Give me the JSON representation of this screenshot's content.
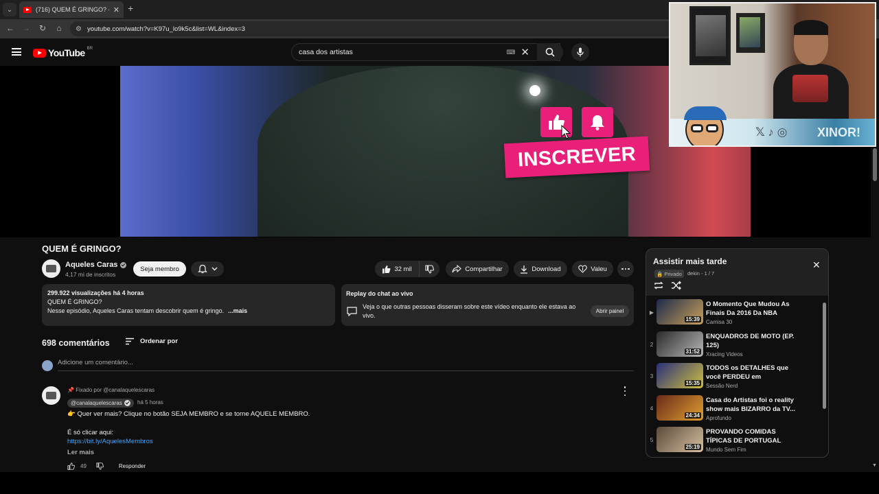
{
  "browser": {
    "tab_title": "(716) QUEM É GRINGO? - YouTube",
    "url": "youtube.com/watch?v=K97u_lo9k5c&list=WL&index=3"
  },
  "header": {
    "logo_text": "YouTube",
    "country": "BR",
    "search_query": "casa dos artistas"
  },
  "overlay": {
    "subscribe_text": "INSCREVER"
  },
  "webcam": {
    "tag_text": "XINOR!"
  },
  "video": {
    "title": "QUEM É GRINGO?",
    "channel": "Aqueles Caras",
    "subscribers": "4,17 mi de inscritos",
    "join_label": "Seja membro",
    "likes": "32 mil",
    "share_label": "Compartilhar",
    "download_label": "Download",
    "thanks_label": "Valeu"
  },
  "description": {
    "stats": "299.922 visualizações  há 4 horas",
    "line1": "QUEM É GRINGO?",
    "line2": "Nesse episódio, Aqueles Caras tentam descobrir quem é gringo.",
    "more": "...mais"
  },
  "chat": {
    "title": "Replay do chat ao vivo",
    "text": "Veja o que outras pessoas disseram sobre este vídeo enquanto ele estava ao vivo.",
    "button": "Abrir painel"
  },
  "comments": {
    "count": "698 comentários",
    "sort_label": "Ordenar por",
    "add_placeholder": "Adicione um comentário...",
    "pinned": {
      "pinned_label": "Fixado por @canalaquelescaras",
      "author": "@canalaquelescaras",
      "time": "há 5 horas",
      "line1": "👉 Quer ver mais? Clique no botão SEJA MEMBRO e se torne AQUELE MEMBRO.",
      "line2": "É só clicar aqui:",
      "link": "https://bit.ly/AquelesMembros",
      "read_more": "Ler mais",
      "likes": "49",
      "reply": "Responder"
    }
  },
  "playlist": {
    "title": "Assistir mais tarde",
    "privacy": "Privado",
    "owner": "dekin - 1 / 7",
    "items": [
      {
        "index": "▶",
        "title": "O Momento Que Mudou As Finais Da 2016 Da NBA",
        "channel": "Camisa 30",
        "duration": "15:39",
        "thumb": [
          "#1d2a4a",
          "#c9a15a"
        ]
      },
      {
        "index": "2",
        "title": "ENQUADROS DE MOTO (EP. 125)",
        "channel": "Xracing Videos",
        "duration": "31:52",
        "thumb": [
          "#2b2b2b",
          "#b8b8b8"
        ]
      },
      {
        "index": "3",
        "title": "TODOS os DETALHES que você PERDEU em QUARTETO...",
        "channel": "Sessão Nerd",
        "duration": "15:35",
        "thumb": [
          "#2a2f7a",
          "#d0c040"
        ]
      },
      {
        "index": "4",
        "title": "Casa do Artistas foi o reality show mais BIZARRO da TV...",
        "channel": "Aprofundo",
        "duration": "24:34",
        "thumb": [
          "#6a2a1a",
          "#e0a030"
        ]
      },
      {
        "index": "5",
        "title": "PROVANDO COMIDAS TÍPICAS DE PORTUGAL",
        "channel": "Mundo Sem Fim",
        "duration": "25:19",
        "thumb": [
          "#5a4a3a",
          "#d8c0a0"
        ]
      }
    ]
  }
}
